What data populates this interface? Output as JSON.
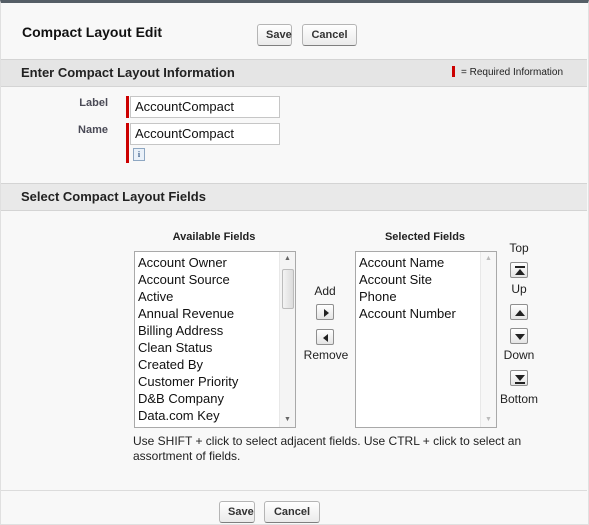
{
  "header": {
    "title": "Compact Layout Edit",
    "save_label": "Save",
    "cancel_label": "Cancel"
  },
  "info_section": {
    "title": "Enter Compact Layout Information",
    "required_legend": "= Required Information",
    "fields": [
      {
        "label": "Label",
        "value": "AccountCompact"
      },
      {
        "label": "Name",
        "value": "AccountCompact"
      }
    ],
    "info_icon_glyph": "i"
  },
  "fields_section": {
    "title": "Select Compact Layout Fields",
    "available_header": "Available Fields",
    "selected_header": "Selected Fields",
    "available_fields": [
      "Account Owner",
      "Account Source",
      "Active",
      "Annual Revenue",
      "Billing Address",
      "Clean Status",
      "Created By",
      "Customer Priority",
      "D&B Company",
      "Data.com Key"
    ],
    "selected_fields": [
      "Account Name",
      "Account Site",
      "Phone",
      "Account Number"
    ],
    "add_label": "Add",
    "remove_label": "Remove",
    "top_label": "Top",
    "up_label": "Up",
    "down_label": "Down",
    "bottom_label": "Bottom",
    "help_line1": "Use SHIFT + click to select adjacent fields. Use CTRL + click to select an",
    "help_line2": "assortment of fields."
  },
  "footer": {
    "save_label": "Save",
    "cancel_label": "Cancel"
  },
  "colors": {
    "required": "#cc0000",
    "section_bar": "#e5e5e5",
    "header_border": "#555e66"
  }
}
